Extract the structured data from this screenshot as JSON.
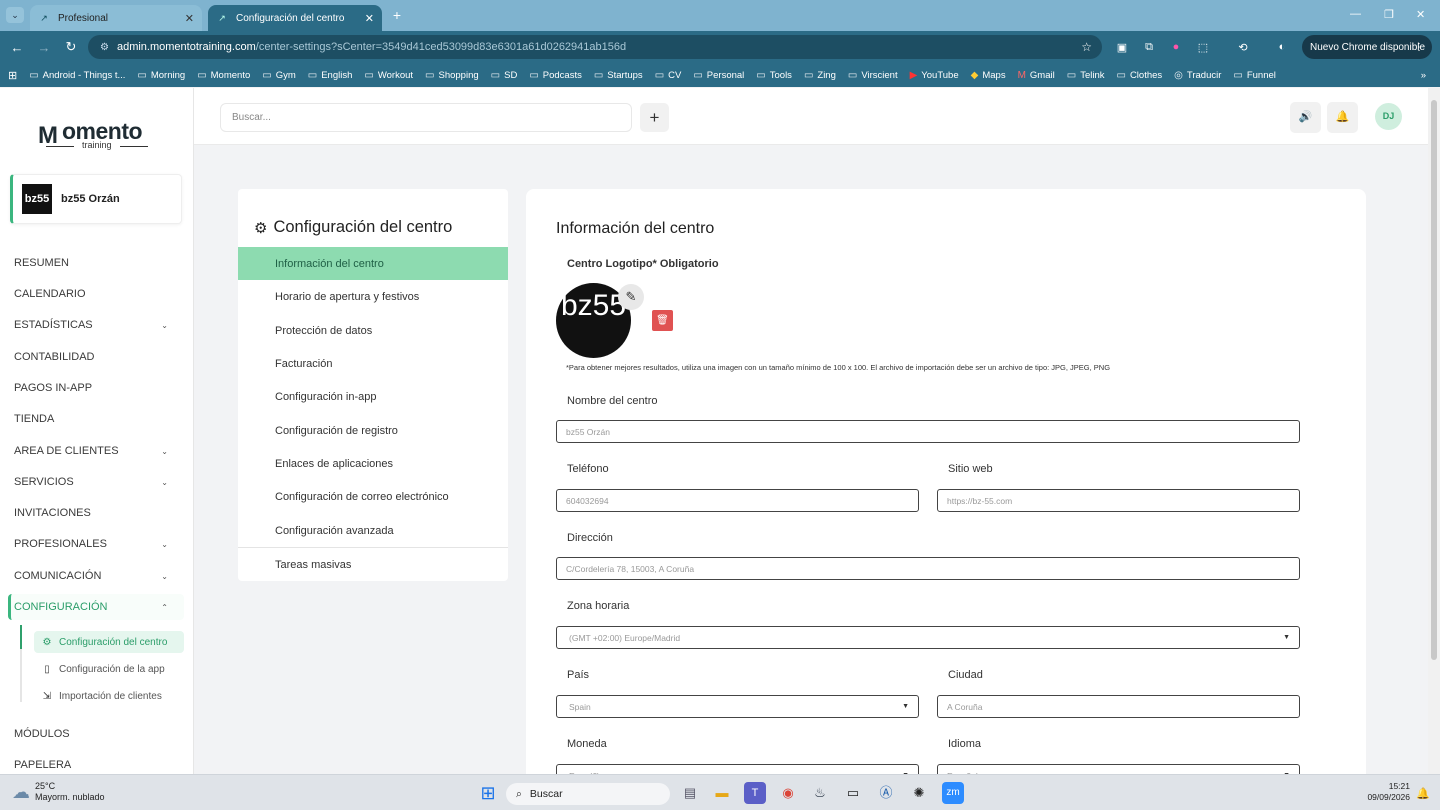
{
  "browser": {
    "tabs": [
      {
        "title": "Profesional"
      },
      {
        "title": "Configuración del centro"
      }
    ],
    "url_host": "admin.momentotraining.com",
    "url_path": "/center-settings?sCenter=3549d41ced53099d83e6301a61d0262941ab156d",
    "update_button": "Nuevo Chrome disponible",
    "bookmarks": [
      "Android - Things t...",
      "Morning",
      "Momento",
      "Gym",
      "English",
      "Workout",
      "Shopping",
      "SD",
      "Podcasts",
      "Startups",
      "CV",
      "Personal",
      "Tools",
      "Zing",
      "Virscient",
      "YouTube",
      "Maps",
      "Gmail",
      "Telink",
      "Clothes",
      "Traducir",
      "Funnel"
    ]
  },
  "sidebar": {
    "logo_word": "omento",
    "logo_sub": "training",
    "center_name": "bz55 Orzán",
    "center_avatar": "bz55",
    "items": [
      {
        "label": "RESUMEN"
      },
      {
        "label": "CALENDARIO"
      },
      {
        "label": "ESTADÍSTICAS"
      },
      {
        "label": "CONTABILIDAD"
      },
      {
        "label": "PAGOS IN-APP"
      },
      {
        "label": "TIENDA"
      },
      {
        "label": "AREA DE CLIENTES"
      },
      {
        "label": "SERVICIOS"
      },
      {
        "label": "INVITACIONES"
      },
      {
        "label": "PROFESIONALES"
      },
      {
        "label": "COMUNICACIÓN"
      },
      {
        "label": "CONFIGURACIÓN"
      },
      {
        "label": "MÓDULOS"
      },
      {
        "label": "PAPELERA"
      }
    ],
    "sub_items": [
      {
        "label": "Configuración del centro"
      },
      {
        "label": "Configuración de la app"
      },
      {
        "label": "Importación de clientes"
      }
    ]
  },
  "header": {
    "search_placeholder": "Buscar...",
    "avatar": "DJ"
  },
  "settings_menu": {
    "title": "Configuración del centro",
    "items": [
      {
        "label": "Información del centro"
      },
      {
        "label": "Horario de apertura y festivos"
      },
      {
        "label": "Protección de datos"
      },
      {
        "label": "Facturación"
      },
      {
        "label": "Configuración in-app"
      },
      {
        "label": "Configuración de registro"
      },
      {
        "label": "Enlaces de aplicaciones"
      },
      {
        "label": "Configuración de correo electrónico"
      },
      {
        "label": "Configuración avanzada"
      },
      {
        "label": "Tareas masivas"
      }
    ]
  },
  "form": {
    "title": "Información del centro",
    "logo_label": "Centro Logotipo* Obligatorio",
    "logo_text": "bz55",
    "hint": "*Para obtener mejores resultados, utiliza una imagen con un tamaño mínimo de 100 x 100. El archivo de importación debe ser un archivo de tipo: JPG, JPEG, PNG",
    "name_label": "Nombre del centro",
    "name_value": "bz55 Orzán",
    "phone_label": "Teléfono",
    "phone_value": "604032694",
    "web_label": "Sitio web",
    "web_value": "https://bz-55.com",
    "address_label": "Dirección",
    "address_value": "C/Cordelería 78, 15003, A Coruña",
    "tz_label": "Zona horaria",
    "tz_value": "(GMT +02:00) Europe/Madrid",
    "country_label": "País",
    "country_value": "Spain",
    "city_label": "Ciudad",
    "city_value": "A Coruña",
    "currency_label": "Moneda",
    "currency_value": "Euro (€)",
    "language_label": "Idioma",
    "language_value": "Español"
  },
  "taskbar": {
    "temp": "25°C",
    "weather": "Mayorm. nublado",
    "search": "Buscar",
    "time": "15:21",
    "date": "09/09/2026"
  }
}
